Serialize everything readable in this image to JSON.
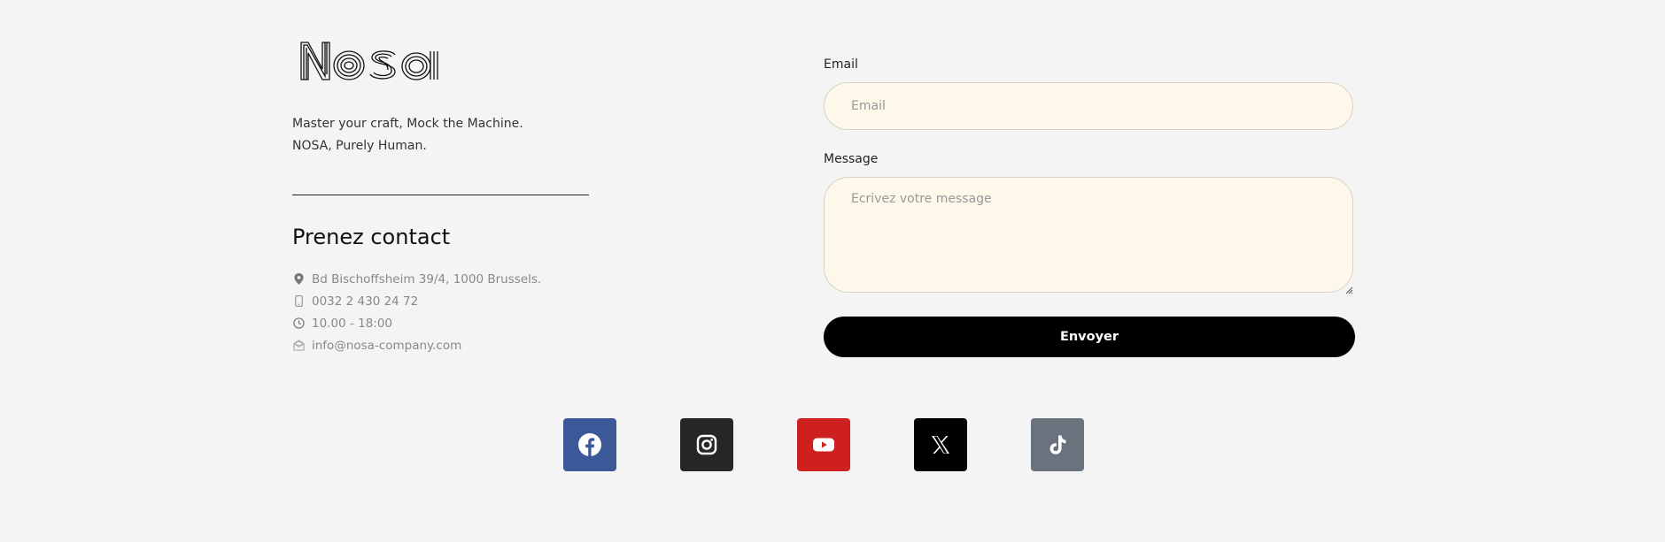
{
  "brand": {
    "logo_text": "Nosa"
  },
  "tagline": [
    "Master your craft, Mock the Machine.",
    "NOSA, Purely Human."
  ],
  "contact": {
    "title": "Prenez contact",
    "items": [
      {
        "icon": "map-pin-icon",
        "text": "Bd Bischoffsheim 39/4, 1000 Brussels."
      },
      {
        "icon": "phone-icon",
        "text": "0032 2 430 24 72"
      },
      {
        "icon": "clock-icon",
        "text": "10.00 - 18:00"
      },
      {
        "icon": "mail-icon",
        "text": "info@nosa-company.com"
      }
    ]
  },
  "form": {
    "email_label": "Email",
    "email_placeholder": "Email",
    "message_label": "Message",
    "message_placeholder": "Ecrivez votre message",
    "submit_label": "Envoyer"
  },
  "social": [
    {
      "name": "facebook-icon",
      "color": "#3b5998"
    },
    {
      "name": "instagram-icon",
      "color": "#262626"
    },
    {
      "name": "youtube-icon",
      "color": "#cd201f"
    },
    {
      "name": "x-icon",
      "color": "#000000"
    },
    {
      "name": "tiktok-icon",
      "color": "#69727d"
    }
  ]
}
